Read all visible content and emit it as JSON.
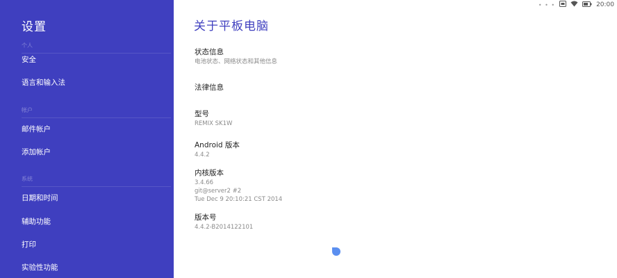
{
  "sidebar": {
    "title": "设置",
    "sections": {
      "personal": "个人",
      "accounts": "帐户",
      "system": "系统"
    },
    "items": {
      "security": "安全",
      "language": "语言和输入法",
      "email_account": "邮件帐户",
      "add_account": "添加帐户",
      "date_time": "日期和时间",
      "accessibility": "辅助功能",
      "printing": "打印",
      "experimental": "实验性功能"
    }
  },
  "status_bar": {
    "dots": "• • •",
    "time": "20:00"
  },
  "main": {
    "title": "关于平板电脑",
    "prefs": {
      "status": {
        "title": "状态信息",
        "summary": "电池状态、网络状态和其他信息"
      },
      "legal": {
        "title": "法律信息"
      },
      "model": {
        "title": "型号",
        "summary": "REMIX SK1W"
      },
      "android_version": {
        "title": "Android 版本",
        "summary": "4.4.2"
      },
      "kernel": {
        "title": "内核版本",
        "summary_lines": [
          "3.4.66",
          "git@server2 #2",
          "Tue Dec 9 20:10:21 CST 2014"
        ]
      },
      "build": {
        "title": "版本号",
        "summary": "4.4.2-B2014122101"
      }
    }
  },
  "colors": {
    "sidebar_bg": "#3f3fbf",
    "accent": "#3f3fbf",
    "pointer": "#5b8ff0"
  }
}
